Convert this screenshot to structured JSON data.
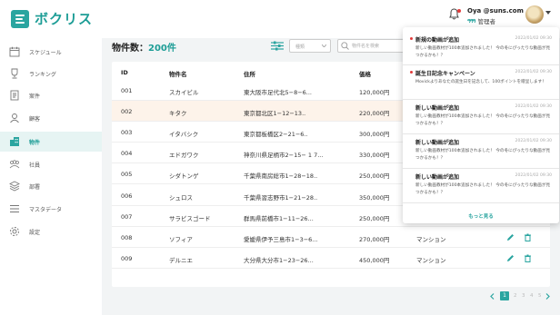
{
  "app": {
    "name": "ボクリス"
  },
  "colors": {
    "accent": "#2aa5a0",
    "highlight_row": "#fdf3ea",
    "active_nav": "#e6f4f3",
    "unread_dot": "#e23b3b"
  },
  "header": {
    "user_email": "Oya @suns.com",
    "user_role": "管理者",
    "role_icons": "ዓዓዓ"
  },
  "sidebar": {
    "items": [
      {
        "label": "スケジュール",
        "icon": "calendar-icon"
      },
      {
        "label": "ランキング",
        "icon": "trophy-icon"
      },
      {
        "label": "案件",
        "icon": "document-icon"
      },
      {
        "label": "顧客",
        "icon": "person-icon"
      },
      {
        "label": "物件",
        "icon": "building-icon",
        "active": true
      },
      {
        "label": "社員",
        "icon": "staff-icon"
      },
      {
        "label": "部署",
        "icon": "layers-icon"
      },
      {
        "label": "マスタデータ",
        "icon": "list-icon"
      },
      {
        "label": "設定",
        "icon": "gear-icon"
      }
    ]
  },
  "main": {
    "title_prefix": "物件数：",
    "title_count": "200件",
    "select_placeholder": "種類",
    "search_placeholder": "物件名を検索",
    "columns": [
      "ID",
      "物件名",
      "住所",
      "価格"
    ],
    "rows": [
      {
        "id": "001",
        "name": "スカイビル",
        "address": "東大阪市足代北5−8−6...",
        "price": "120,000円",
        "type": ""
      },
      {
        "id": "002",
        "name": "キタク",
        "address": "東京都北区1−12−13..",
        "price": "220,000円",
        "type": ""
      },
      {
        "id": "003",
        "name": "イタバシク",
        "address": "東京都板橋区2−21−6..",
        "price": "300,000円",
        "type": ""
      },
      {
        "id": "004",
        "name": "エドガワク",
        "address": "神奈川県足柄市2−15− 1 7...",
        "price": "330,000円",
        "type": ""
      },
      {
        "id": "005",
        "name": "シダトンゲ",
        "address": "千葉県南房総市1−28−18..",
        "price": "250,000円",
        "type": ""
      },
      {
        "id": "006",
        "name": "シュロス",
        "address": "千葉県習志野市1−21−28..",
        "price": "350,000円",
        "type": ""
      },
      {
        "id": "007",
        "name": "サラビスゴード",
        "address": "群馬県前橋市1−11−26...",
        "price": "250,000円",
        "type": ""
      },
      {
        "id": "008",
        "name": "ソフィア",
        "address": "愛媛県伊予三島市1−3−6...",
        "price": "270,000円",
        "type": "マンション"
      },
      {
        "id": "009",
        "name": "デルニエ",
        "address": "大分県大分市1−23−26...",
        "price": "450,000円",
        "type": "マンション"
      }
    ],
    "pagination": {
      "current": "1",
      "pages": [
        "2",
        "3",
        "4",
        "5"
      ]
    }
  },
  "notifications": {
    "items": [
      {
        "title": "新規の動画が追加",
        "date": "2022/01/02 09:30",
        "body": "新しい動画教材が100本追加されました！ 今の冬にぴったりな動画が見つかるかも！？",
        "unread": true
      },
      {
        "title": "誕生日記念キャンペーン",
        "date": "2022/01/02 09:30",
        "body": "Movickよりあなたの誕生日を記念して、100ポイントを贈呈します！",
        "unread": true
      },
      {
        "title": "新しい動画が追加",
        "date": "2022/01/02 09:30",
        "body": "新しい動画教材が100本追加されました！ 今の冬にぴったりな動画が見つかるかも！？",
        "unread": false
      },
      {
        "title": "新しい動画が追加",
        "date": "2022/01/02 09:30",
        "body": "新しい動画教材が100本追加されました！ 今の冬にぴったりな動画が見つかるかも！？",
        "unread": false
      },
      {
        "title": "新しい動画が追加",
        "date": "2022/01/02 09:30",
        "body": "新しい動画教材が100本追加されました！ 今の冬にぴったりな動画が見つかるかも！？",
        "unread": false
      }
    ],
    "more_label": "もっと見る"
  }
}
